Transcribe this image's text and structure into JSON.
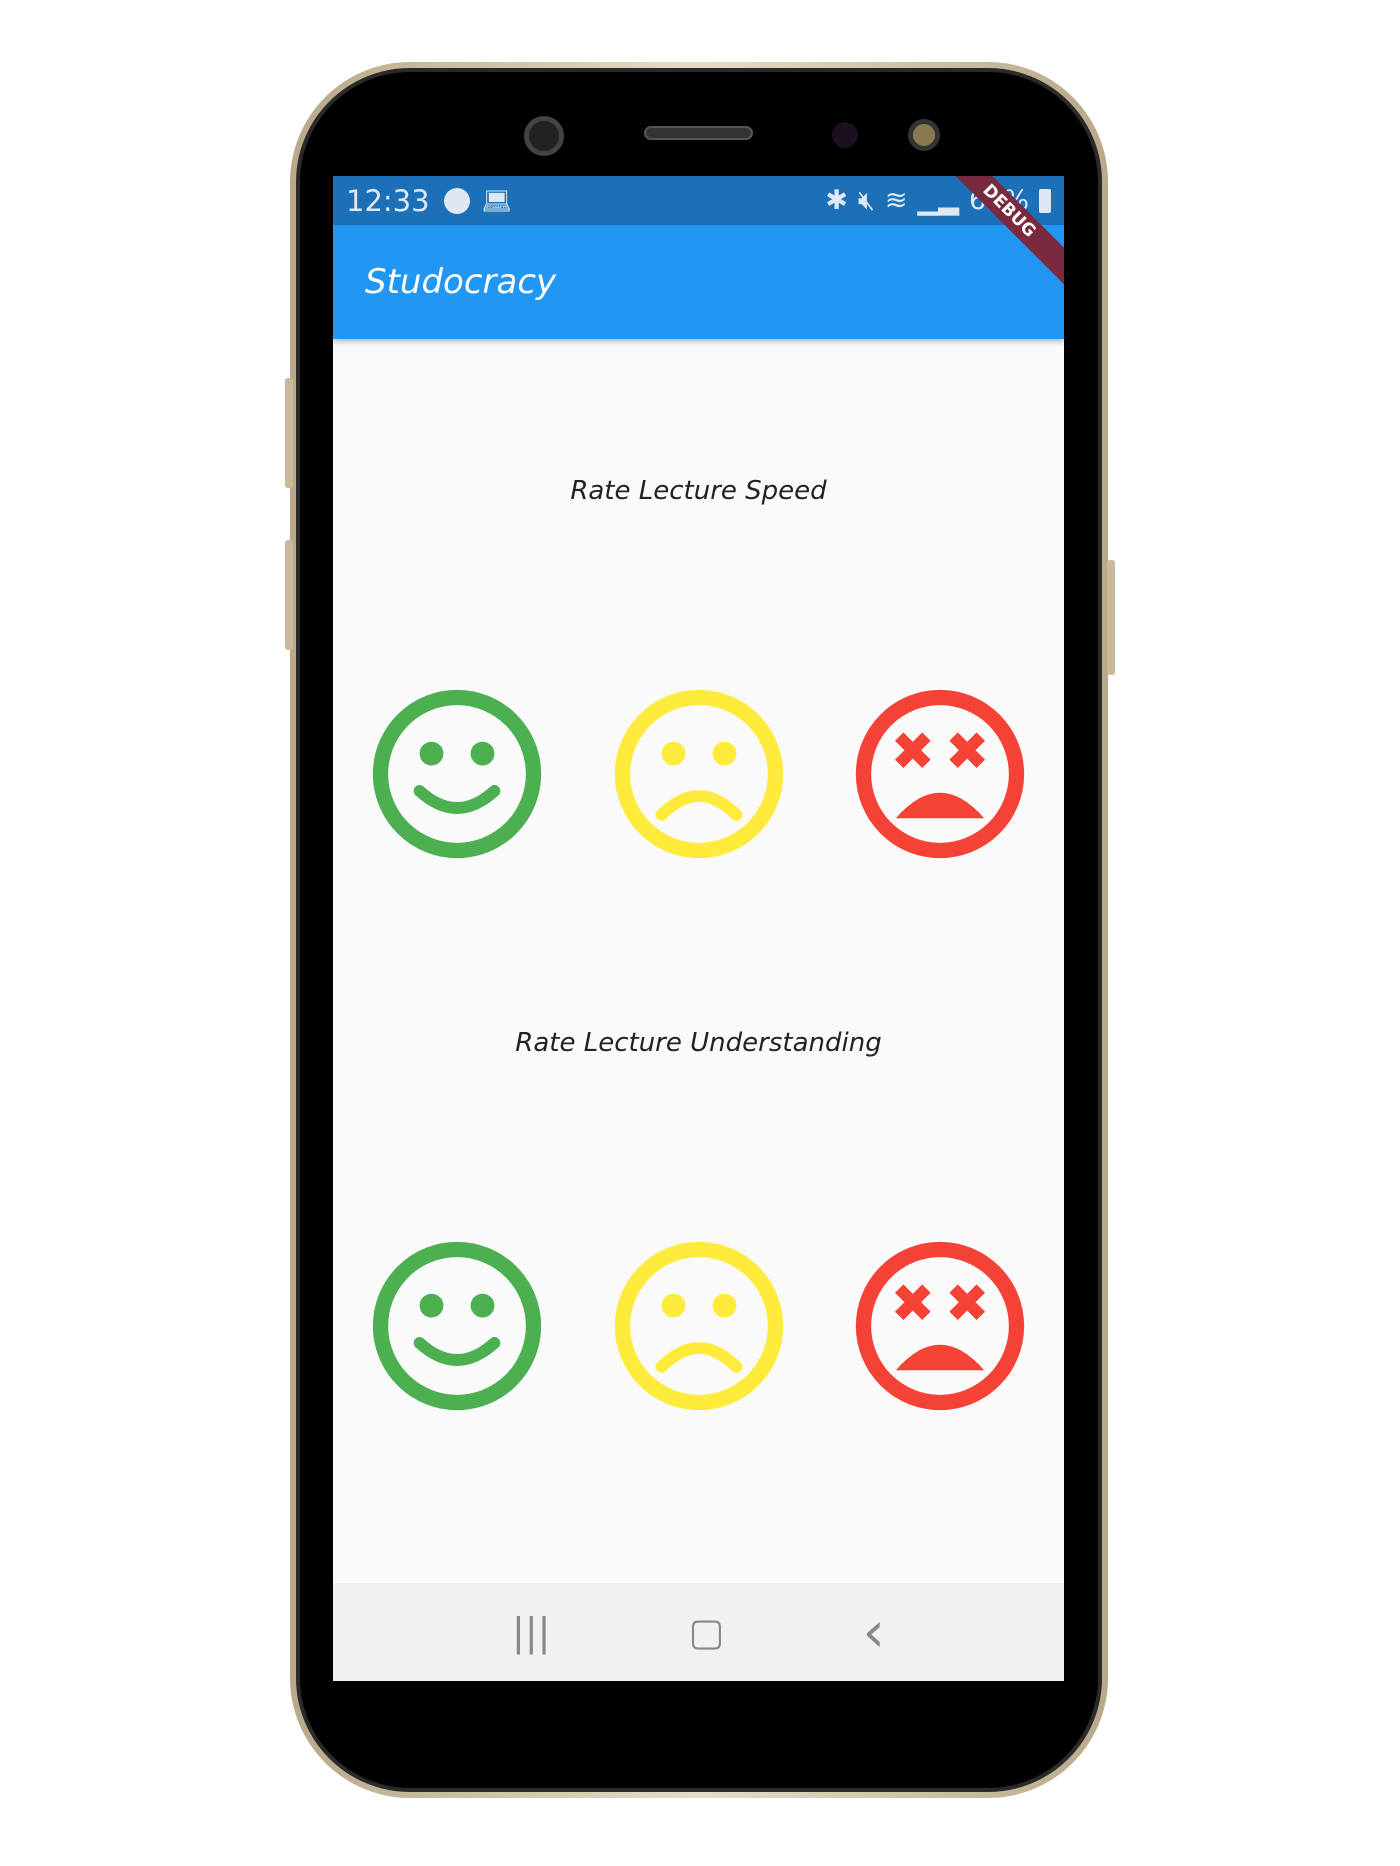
{
  "status_bar": {
    "time": "12:33",
    "battery": "62%",
    "left_icons": [
      "spotify-icon",
      "laptop-icon"
    ],
    "right_icons": [
      "bluetooth-icon",
      "mute-icon",
      "wifi-icon",
      "signal-icon",
      "battery-icon"
    ]
  },
  "debug_banner": "DEBUG",
  "app_bar": {
    "title": "Studocracy"
  },
  "sections": [
    {
      "title": "Rate Lecture Speed",
      "options": [
        {
          "name": "happy",
          "color": "#4caf50"
        },
        {
          "name": "sad",
          "color": "#ffeb3b"
        },
        {
          "name": "dead",
          "color": "#f44336"
        }
      ]
    },
    {
      "title": "Rate Lecture Understanding",
      "options": [
        {
          "name": "happy",
          "color": "#4caf50"
        },
        {
          "name": "sad",
          "color": "#ffeb3b"
        },
        {
          "name": "dead",
          "color": "#f44336"
        }
      ]
    }
  ],
  "nav_bar": {
    "recents": "|||",
    "home": "▢",
    "back": "‹"
  }
}
